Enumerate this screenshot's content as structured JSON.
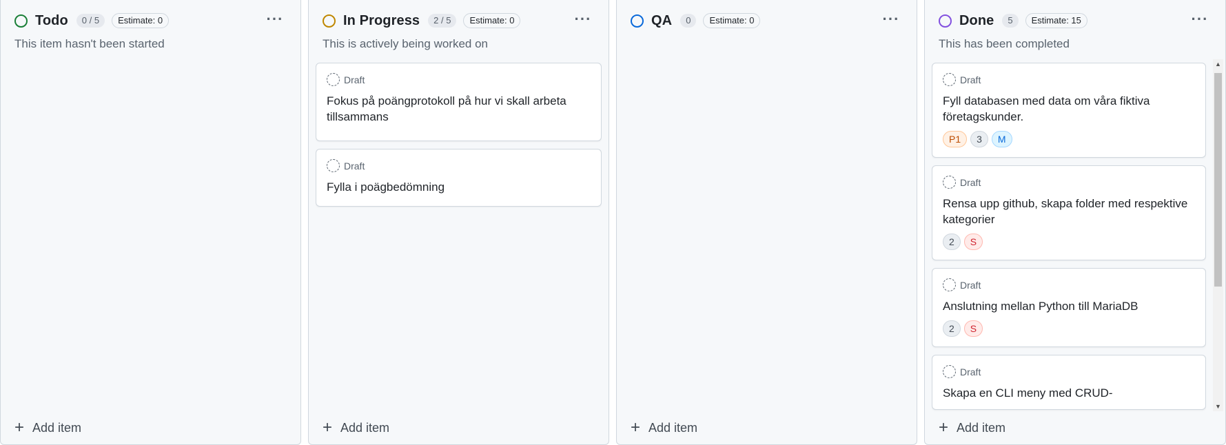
{
  "colors": {
    "todo": "#1a7f37",
    "in_progress": "#bf8700",
    "qa": "#0969da",
    "done": "#8250df"
  },
  "columns": [
    {
      "title": "Todo",
      "count": "0 / 5",
      "estimate": "Estimate: 0",
      "description": "This item hasn't been started",
      "status_icon": "circle-icon",
      "add_label": "Add item",
      "cards": []
    },
    {
      "title": "In Progress",
      "count": "2 / 5",
      "estimate": "Estimate: 0",
      "description": "This is actively being worked on",
      "status_icon": "circle-icon",
      "add_label": "Add item",
      "cards": [
        {
          "type": "Draft",
          "title": "Fokus på poängprotokoll på hur vi skall arbeta tillsammans",
          "labels": []
        },
        {
          "type": "Draft",
          "title": "Fylla i poägbedömning",
          "labels": []
        }
      ]
    },
    {
      "title": "QA",
      "count": "0",
      "estimate": "Estimate: 0",
      "description": "",
      "status_icon": "circle-icon",
      "add_label": "Add item",
      "cards": []
    },
    {
      "title": "Done",
      "count": "5",
      "estimate": "Estimate: 15",
      "description": "This has been completed",
      "status_icon": "circle-icon",
      "add_label": "Add item",
      "cards": [
        {
          "type": "Draft",
          "title": "Fyll databasen med data om våra fiktiva företagskunder.",
          "labels": [
            {
              "text": "P1",
              "style": "orange"
            },
            {
              "text": "3",
              "style": "gray"
            },
            {
              "text": "M",
              "style": "blue"
            }
          ]
        },
        {
          "type": "Draft",
          "title": "Rensa upp github, skapa folder med respektive kategorier",
          "labels": [
            {
              "text": "2",
              "style": "gray"
            },
            {
              "text": "S",
              "style": "red"
            }
          ]
        },
        {
          "type": "Draft",
          "title": "Anslutning mellan Python till MariaDB",
          "labels": [
            {
              "text": "2",
              "style": "gray"
            },
            {
              "text": "S",
              "style": "red"
            }
          ]
        },
        {
          "type": "Draft",
          "title": "Skapa en CLI meny med CRUD-",
          "labels": []
        }
      ]
    }
  ],
  "icons": {
    "menu": "kebab-horizontal-icon",
    "add": "plus-icon",
    "draft": "draft-issue-icon"
  },
  "menu_glyph": "···",
  "plus_glyph": "+"
}
